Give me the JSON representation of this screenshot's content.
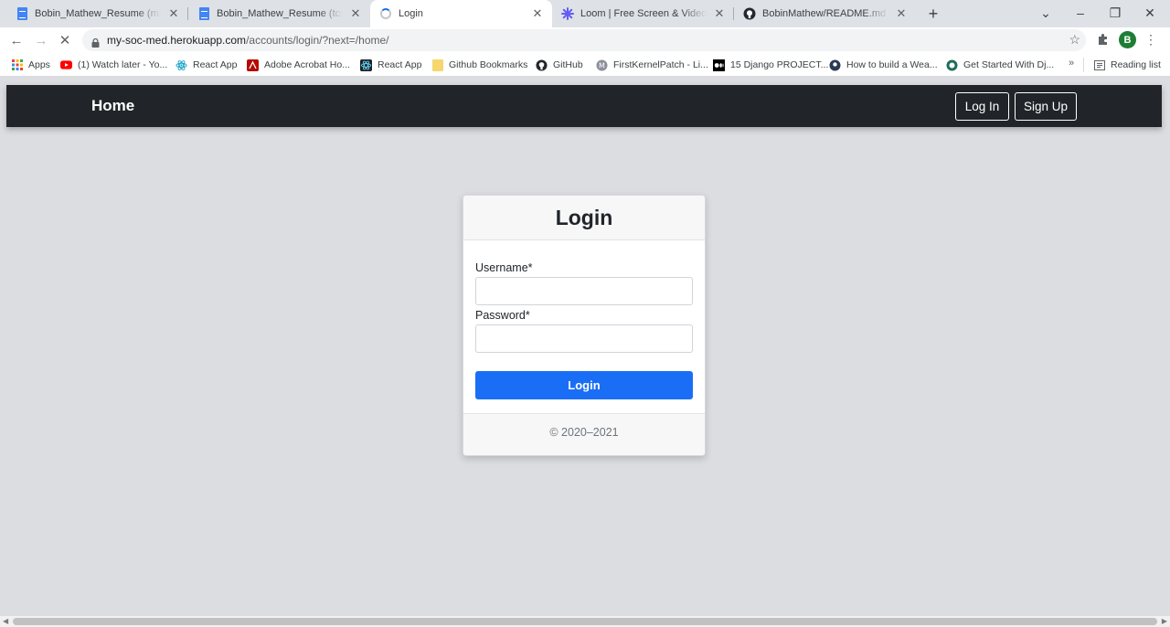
{
  "browser": {
    "tabs": [
      {
        "title": "Bobin_Mathew_Resume (m2) - Go",
        "icon": "google-docs-icon",
        "active": false
      },
      {
        "title": "Bobin_Mathew_Resume (tcs) - Go",
        "icon": "google-docs-icon",
        "active": false
      },
      {
        "title": "Login",
        "icon": "loading-spinner-icon",
        "active": true
      },
      {
        "title": "Loom | Free Screen & Video Reco",
        "icon": "loom-icon",
        "active": false
      },
      {
        "title": "BobinMathew/README.md at ma",
        "icon": "github-icon",
        "active": false
      }
    ],
    "url_host": "my-soc-med.herokuapp.com",
    "url_path": "/accounts/login/?next=/home/",
    "profile_initial": "B",
    "bookmarks": [
      {
        "label": "Apps",
        "icon": "apps-grid-icon"
      },
      {
        "label": "(1) Watch later - Yo...",
        "icon": "youtube-icon"
      },
      {
        "label": "React App",
        "icon": "react-icon"
      },
      {
        "label": "Adobe Acrobat Ho...",
        "icon": "acrobat-icon"
      },
      {
        "label": "React App",
        "icon": "react-icon"
      },
      {
        "label": "Github Bookmarks",
        "icon": "folder-icon"
      },
      {
        "label": "GitHub",
        "icon": "github-icon"
      },
      {
        "label": "FirstKernelPatch - Li...",
        "icon": "linux-icon"
      },
      {
        "label": "15 Django PROJECT...",
        "icon": "medium-icon"
      },
      {
        "label": "How to build a Wea...",
        "icon": "site-icon"
      },
      {
        "label": "Get Started With Dj...",
        "icon": "site-icon"
      }
    ],
    "more_bookmarks": "»",
    "reading_list": "Reading list"
  },
  "site": {
    "brand": "Home",
    "login_button": "Log In",
    "signup_button": "Sign Up"
  },
  "login_card": {
    "title": "Login",
    "username_label": "Username*",
    "username_value": "",
    "password_label": "Password*",
    "password_value": "",
    "submit_label": "Login",
    "footer": "© 2020–2021"
  },
  "colors": {
    "navbar": "#212529",
    "primary_button": "#1a6ef5",
    "page_background": "#dcdde1"
  }
}
